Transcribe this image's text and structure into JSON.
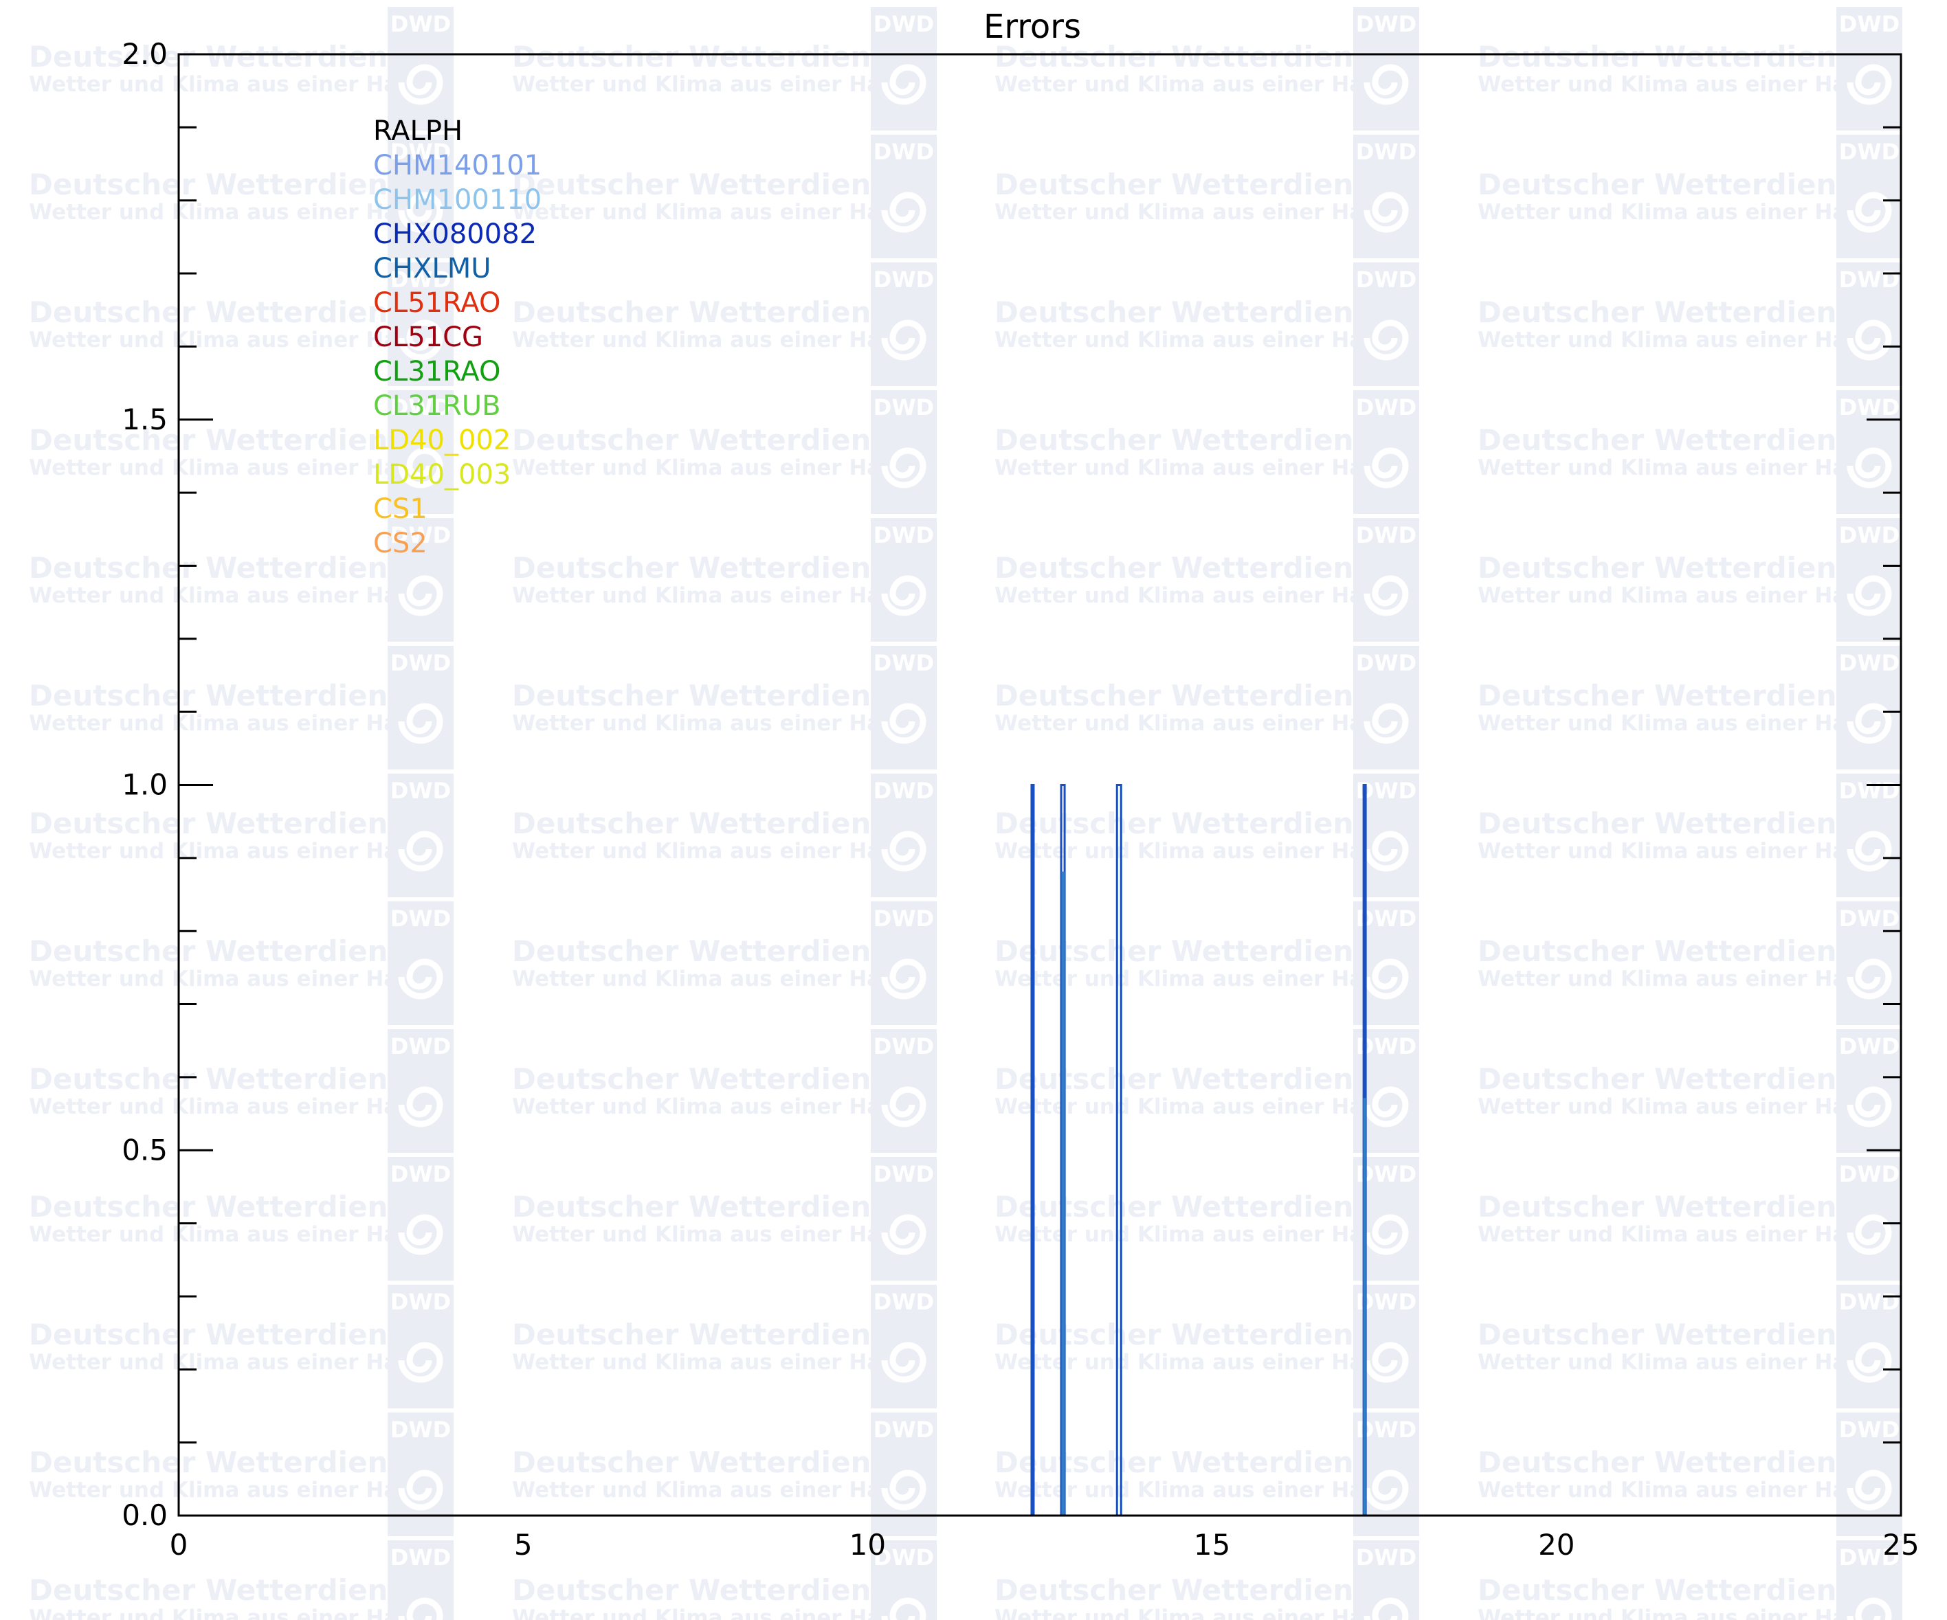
{
  "chart_data": {
    "type": "line",
    "title": "Errors",
    "xlabel": "",
    "ylabel": "",
    "xlim": [
      0,
      25
    ],
    "ylim": [
      0,
      2
    ],
    "xticks": [
      0,
      5,
      10,
      15,
      20,
      25
    ],
    "xtick_labels": [
      "0",
      "5",
      "10",
      "15",
      "20",
      "25"
    ],
    "yticks": [
      0,
      0.5,
      1,
      1.5,
      2
    ],
    "ytick_labels": [
      "0.0",
      "0.5",
      "1.0",
      "1.5",
      "2.0"
    ],
    "y_minor_step": 0.1,
    "grid": false,
    "legend_position": "top-left",
    "legend": [
      {
        "name": "RALPH",
        "color": "#000000"
      },
      {
        "name": "CHM140101",
        "color": "#7b9fe8"
      },
      {
        "name": "CHM100110",
        "color": "#8ec4ec"
      },
      {
        "name": "CHX080082",
        "color": "#0a2ab5"
      },
      {
        "name": "CHXLMU",
        "color": "#1060a8"
      },
      {
        "name": "CL51RAO",
        "color": "#e03010"
      },
      {
        "name": "CL51CG",
        "color": "#a00010"
      },
      {
        "name": "CL31RAO",
        "color": "#10a010"
      },
      {
        "name": "CL31RUB",
        "color": "#60d040"
      },
      {
        "name": "LD40_002",
        "color": "#f0e000"
      },
      {
        "name": "LD40_003",
        "color": "#d8e820"
      },
      {
        "name": "CS1",
        "color": "#f8c020"
      },
      {
        "name": "CS2",
        "color": "#f8a050"
      }
    ],
    "series": [
      {
        "name": "CHX080082",
        "color": "#1a4fc0",
        "x": [
          0,
          12.38,
          12.38,
          12.41,
          12.41,
          12.81,
          12.81,
          12.86,
          12.86,
          13.62,
          13.62,
          13.68,
          13.68,
          17.2,
          17.2,
          17.23,
          17.23,
          25
        ],
        "y": [
          0,
          0,
          1,
          1,
          0,
          0,
          1,
          1,
          0,
          0,
          1,
          1,
          0,
          0,
          1,
          1,
          0,
          0
        ]
      },
      {
        "name": "CHXLMU",
        "color": "#2e7fc8",
        "x": [
          0,
          12.83,
          12.83,
          12.85,
          12.85,
          17.21,
          17.21,
          17.22,
          17.22,
          25
        ],
        "y": [
          0,
          0,
          0.88,
          0.88,
          0,
          0,
          0.57,
          0.57,
          0,
          0
        ]
      }
    ]
  },
  "watermark": {
    "brand": "Deutscher Wetterdienst",
    "slogan": "Wetter und Klima aus einer Hand",
    "logo_text": "DWD",
    "logo_color": "#eaedf3",
    "text_color": "#eceff5"
  }
}
